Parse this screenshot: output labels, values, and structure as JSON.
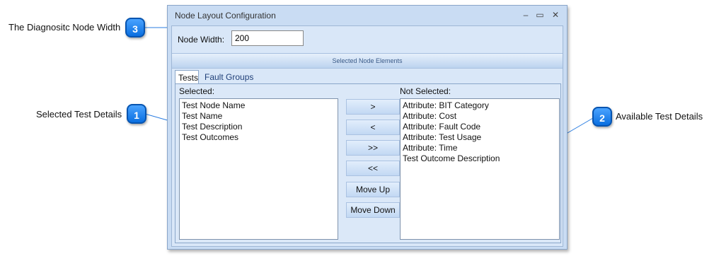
{
  "callouts": [
    {
      "number": "3",
      "label": "The Diagnositc Node Width"
    },
    {
      "number": "1",
      "label": "Selected Test Details"
    },
    {
      "number": "2",
      "label": "Available Test Details"
    }
  ],
  "window": {
    "title": "Node Layout Configuration",
    "controls": {
      "minimize": "–",
      "maximize": "▭",
      "close": "✕"
    }
  },
  "node_width": {
    "label": "Node Width:",
    "value": "200"
  },
  "section_title": "Selected Node Elements",
  "tabs": [
    {
      "label": "Tests",
      "active": true
    },
    {
      "label": "Fault Groups",
      "active": false
    }
  ],
  "selected": {
    "label": "Selected:",
    "items": [
      "Test Node Name",
      "Test Name",
      "Test Description",
      "Test Outcomes"
    ]
  },
  "not_selected": {
    "label": "Not Selected:",
    "items": [
      "Attribute: BIT Category",
      "Attribute: Cost",
      "Attribute: Fault Code",
      "Attribute: Test Usage",
      "Attribute: Time",
      "Test Outcome Description"
    ]
  },
  "buttons": {
    "add": ">",
    "remove": "<",
    "add_all": ">>",
    "remove_all": "<<",
    "move_up": "Move Up",
    "move_down": "Move Down"
  },
  "colors": {
    "badge": "#0a6fe0",
    "window_bg": "#c9dcf3",
    "leader_line": "#2a7de1"
  }
}
